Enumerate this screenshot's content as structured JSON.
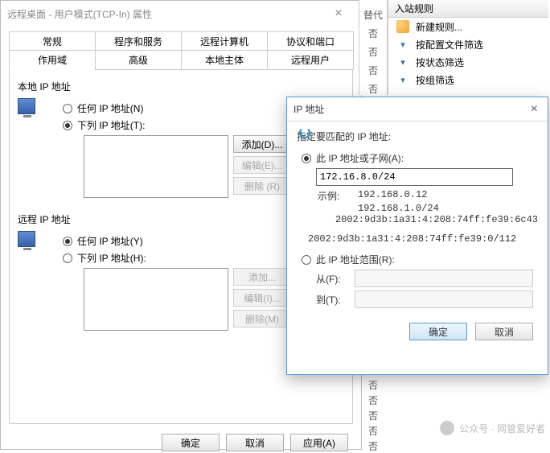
{
  "props": {
    "title": "远程桌面 - 用户模式(TCP-In) 属性",
    "close": "×",
    "tabs_top": [
      "常规",
      "程序和服务",
      "远程计算机",
      "协议和端口"
    ],
    "tabs_bot": [
      "作用域",
      "高级",
      "本地主体",
      "远程用户"
    ],
    "local_group": "本地 IP 地址",
    "remote_group": "远程 IP 地址",
    "any_ip_n": "任何 IP 地址(N)",
    "list_ip_t": "下列 IP 地址(T):",
    "any_ip_y": "任何 IP 地址(Y)",
    "list_ip_h": "下列 IP 地址(H):",
    "btn_add": "添加(D)...",
    "btn_edit": "编辑(E)...",
    "btn_remove": "删除 (R)",
    "btn_add2": "添加...",
    "btn_edit2": "编辑(I)...",
    "btn_remove2": "删除(M)",
    "btn_ok": "确定",
    "btn_cancel": "取消",
    "btn_apply": "应用(A)"
  },
  "ipdlg": {
    "title": "IP 地址",
    "close": "×",
    "match_label": "指定要匹配的 IP 地址:",
    "radio_subnet": "此 IP 地址或子网(A):",
    "input_value": "172.16.8.0/24",
    "example_label": "示例:",
    "example1": "192.168.0.12",
    "example2": "192.168.1.0/24",
    "example3": "2002:9d3b:1a31:4:208:74ff:fe39:6c43",
    "example_extra": "2002:9d3b:1a31:4:208:74ff:fe39:0/112",
    "radio_range": "此 IP 地址范围(R):",
    "from_label": "从(F):",
    "to_label": "到(T):",
    "ok": "确定",
    "cancel": "取消"
  },
  "side": {
    "c0": "替代",
    "c1": "否",
    "c2": "否",
    "c3": "否",
    "c4": "否",
    "c5": "否",
    "c6": "否",
    "c7": "否",
    "c8": "否",
    "c9": "否"
  },
  "inbox": {
    "header": "入站规则",
    "new": "新建规则...",
    "by_config": "按配置文件筛选",
    "by_state": "按状态筛选",
    "by_group": "按组筛选"
  },
  "watermark": "公众号 · 网管爱好者"
}
